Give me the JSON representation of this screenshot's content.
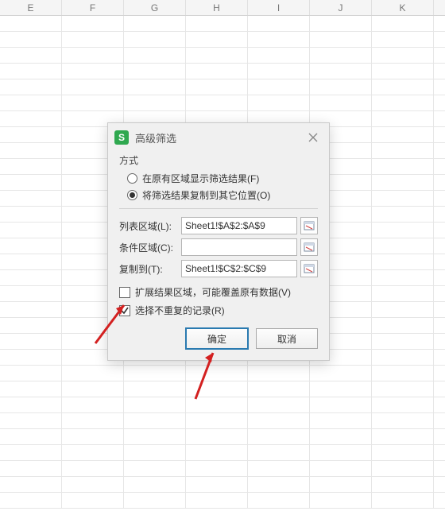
{
  "columns": [
    "E",
    "F",
    "G",
    "H",
    "I",
    "J",
    "K"
  ],
  "dialog": {
    "title": "高级筛选",
    "appIconGlyph": "S",
    "sectionMode": "方式",
    "radioInPlace": "在原有区域显示筛选结果(F)",
    "radioCopy": "将筛选结果复制到其它位置(O)",
    "fieldListLabel": "列表区域(L):",
    "fieldListValue": "Sheet1!$A$2:$A$9",
    "fieldCondLabel": "条件区域(C):",
    "fieldCondValue": "",
    "fieldCopyLabel": "复制到(T):",
    "fieldCopyValue": "Sheet1!$C$2:$C$9",
    "checkExpand": "扩展结果区域，可能覆盖原有数据(V)",
    "checkUnique": "选择不重复的记录(R)",
    "btnOk": "确定",
    "btnCancel": "取消"
  }
}
